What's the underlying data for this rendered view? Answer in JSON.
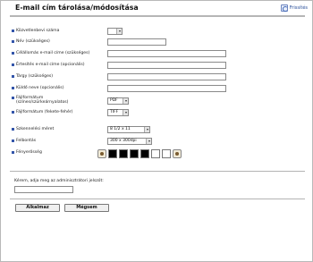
{
  "header": {
    "title": "E-mail cím tárolása/módosítása",
    "refresh_label": "Frissítés"
  },
  "form": {
    "destination_number": {
      "label": "Közvetlenbevi száma",
      "value": ""
    },
    "name": {
      "label": "Név (szükséges)",
      "value": ""
    },
    "dest_email": {
      "label": "Célállomás e-mail címe (szükséges)",
      "value": ""
    },
    "notify_email": {
      "label": "Értesítés e-mail címe (opcionális)",
      "value": ""
    },
    "subject": {
      "label": "Tárgy (szükséges)",
      "value": ""
    },
    "sender_name": {
      "label": "Küldő neve (opcionális)",
      "value": ""
    },
    "file_format_color": {
      "label_line1": "Fájlformátum",
      "label_line2": "(színes/szürkeárnyalatos)",
      "value": "PDF"
    },
    "file_format_bw": {
      "label": "Fájlformátum (fekete-fehér)",
      "value": "TIFF"
    },
    "scan_size": {
      "label": "Szkennelési méret",
      "value": "8 1/2 x 11"
    },
    "resolution": {
      "label": "Felbontás",
      "value": "300 x 300dpi"
    },
    "density": {
      "label": "Fényerősség"
    }
  },
  "admin": {
    "prompt": "Kérem, adja meg az adminisztrátori jelszót:",
    "password_value": ""
  },
  "buttons": {
    "apply": "Alkalmaz",
    "cancel": "Mégsem"
  },
  "colors": {
    "bullet": "#3355aa",
    "link": "#2a4f9a"
  }
}
